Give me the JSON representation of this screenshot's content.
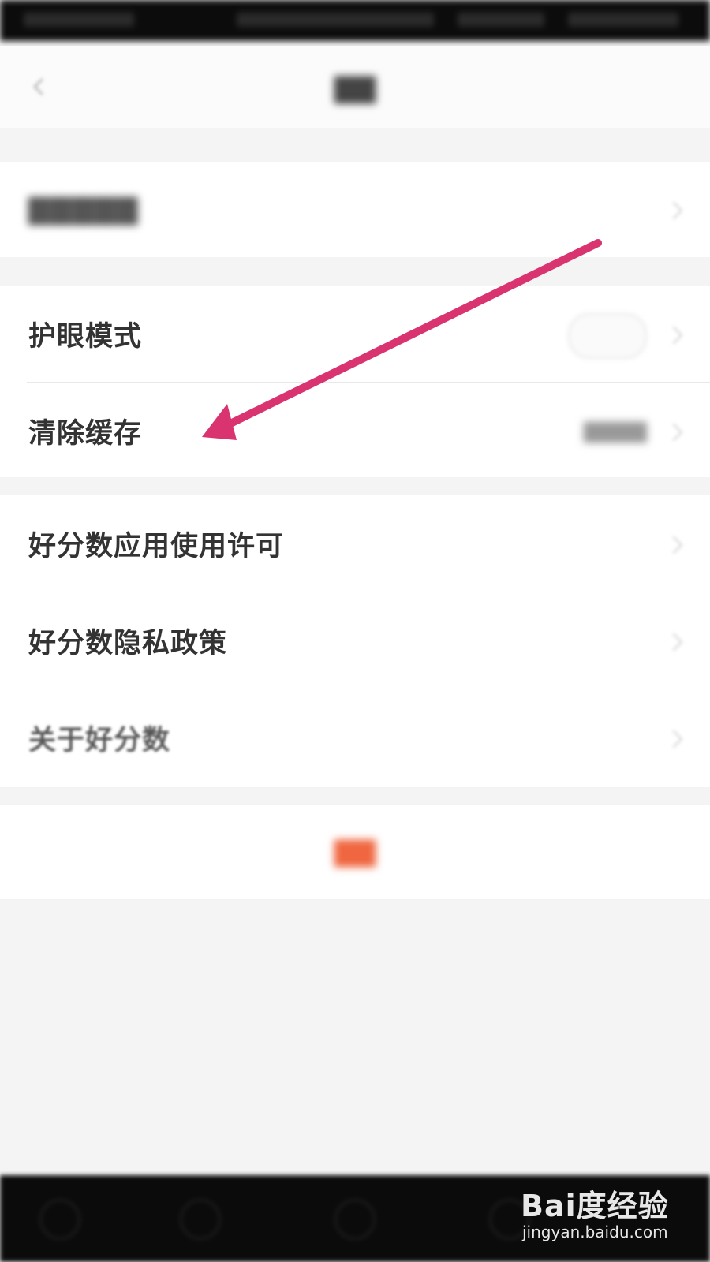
{
  "settings": {
    "eye_mode": "护眼模式",
    "clear_cache": "清除缓存",
    "license": "好分数应用使用许可",
    "privacy": "好分数隐私政策",
    "about": "关于好分数"
  },
  "annotation": {
    "arrow_color": "#d9346f"
  },
  "watermark": {
    "brand": "Bai度经验",
    "url": "jingyan.baidu.com"
  }
}
